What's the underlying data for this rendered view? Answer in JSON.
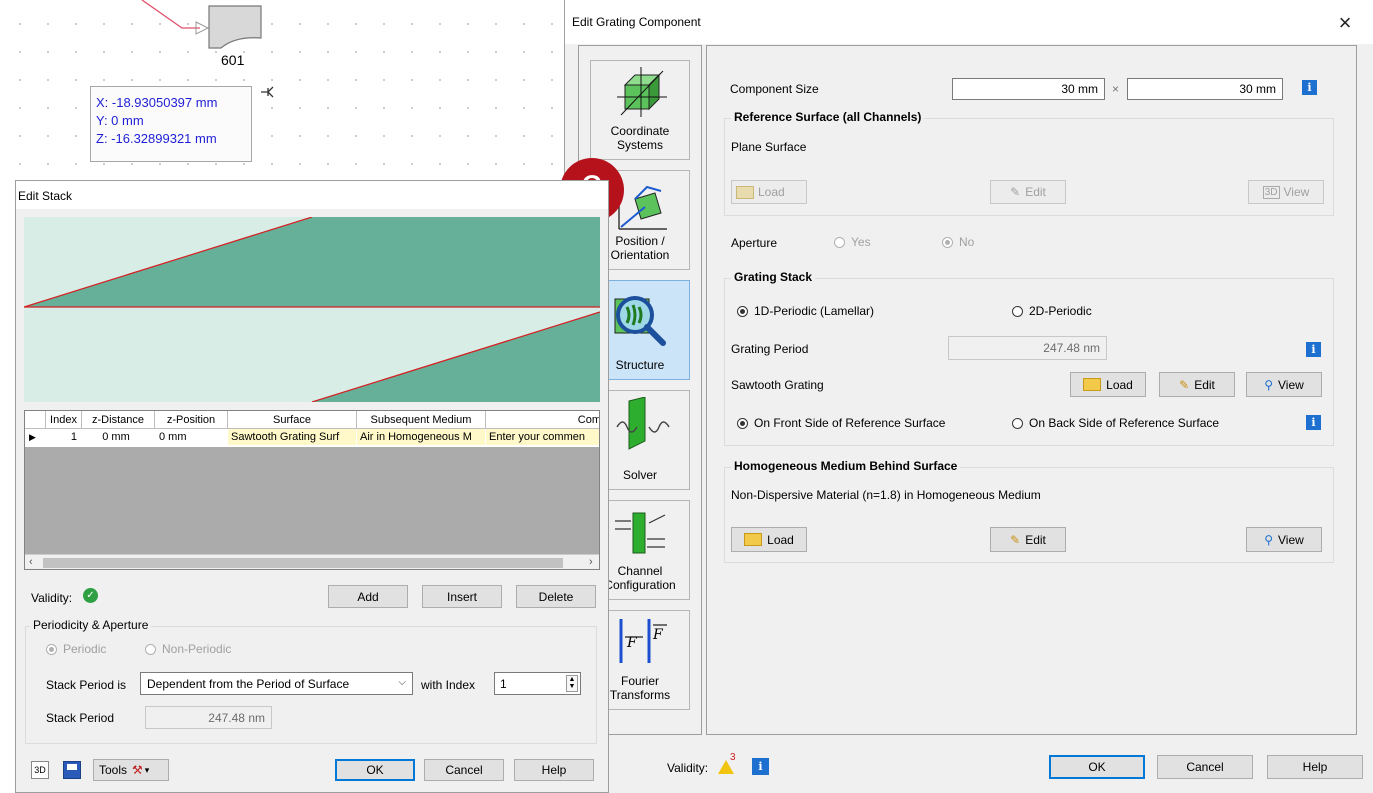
{
  "canvas": {
    "element_label": "601",
    "coords": {
      "x": "X: -18.93050397 mm",
      "y": "Y: 0 mm",
      "z": "Z: -16.32899321 mm"
    }
  },
  "badge": "2",
  "grating_dialog": {
    "title": "Edit Grating Component",
    "close": "×",
    "nav": [
      {
        "label": "Coordinate Systems",
        "line1": "Coordinate",
        "line2": "Systems"
      },
      {
        "label": "Position / Orientation",
        "line1": "Position /",
        "line2": "Orientation"
      },
      {
        "label": "Structure",
        "line1": "Structure",
        "line2": ""
      },
      {
        "label": "Solver",
        "line1": "Solver",
        "line2": ""
      },
      {
        "label": "Channel Configuration",
        "line1": "Channel",
        "line2": "Configuration"
      },
      {
        "label": "Fourier Transforms",
        "line1": "Fourier",
        "line2": "Transforms"
      }
    ],
    "component_size_label": "Component Size",
    "size_x": "30 mm",
    "size_sep": "×",
    "size_y": "30 mm",
    "ref_surface_title": "Reference Surface (all Channels)",
    "ref_surface_value": "Plane Surface",
    "load": "Load",
    "edit": "Edit",
    "view": "View",
    "aperture_label": "Aperture",
    "aperture_yes": "Yes",
    "aperture_no": "No",
    "grating_stack_title": "Grating Stack",
    "periodic_1d": "1D-Periodic (Lamellar)",
    "periodic_2d": "2D-Periodic",
    "grating_period_label": "Grating Period",
    "grating_period_value": "247.48 nm",
    "sawtooth_label": "Sawtooth Grating",
    "front_side": "On Front Side of Reference Surface",
    "back_side": "On Back Side of Reference Surface",
    "homog_title": "Homogeneous Medium Behind Surface",
    "homog_value": "Non-Dispersive Material (n=1.8) in Homogeneous Medium",
    "validity_label": "Validity:",
    "validity_count": "3",
    "ok": "OK",
    "cancel": "Cancel",
    "help": "Help"
  },
  "stack_dialog": {
    "title": "Edit Stack",
    "table": {
      "headers": [
        "Index",
        "z-Distance",
        "z-Position",
        "Surface",
        "Subsequent Medium",
        "Com"
      ],
      "rows": [
        {
          "index": "1",
          "z_distance": "0 mm",
          "z_position": "0 mm",
          "surface": "Sawtooth Grating Surf",
          "medium": "Air in Homogeneous M",
          "comment": "Enter your commen"
        }
      ]
    },
    "validity_label": "Validity:",
    "add": "Add",
    "insert": "Insert",
    "delete": "Delete",
    "periodicity_title": "Periodicity & Aperture",
    "periodic": "Periodic",
    "non_periodic": "Non-Periodic",
    "stack_period_is_label": "Stack Period is",
    "stack_period_mode": "Dependent from the Period of Surface",
    "with_index_label": "with Index",
    "with_index_value": "1",
    "stack_period_label": "Stack Period",
    "stack_period_value": "247.48 nm",
    "tools": "Tools",
    "ok": "OK",
    "cancel": "Cancel",
    "help": "Help"
  },
  "colors": {
    "accent": "#0078d7",
    "badge": "#b5121b",
    "stack_fill": "#66b09a",
    "stack_bg": "#d8ede6",
    "info": "#1d6fd0",
    "field_text": "#1f1fd6"
  }
}
